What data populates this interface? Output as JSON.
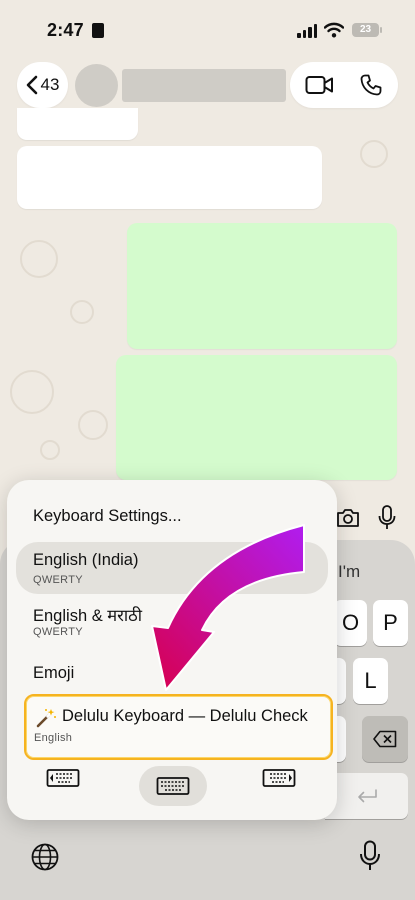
{
  "status_bar": {
    "time": "2:47",
    "battery": "23"
  },
  "nav": {
    "back_count": "43"
  },
  "keyboard": {
    "suggestion": "I'm",
    "keys_row2": [
      "O",
      "P"
    ],
    "keys_row3": [
      "L"
    ]
  },
  "popup": {
    "settings": "Keyboard Settings...",
    "items": [
      {
        "label": "English (India)",
        "sub": "QWERTY"
      },
      {
        "label": "English & मराठी",
        "sub": "QWERTY"
      },
      {
        "label": "Emoji"
      },
      {
        "label": "Delulu Keyboard — Delulu Check",
        "sub": "English"
      }
    ]
  },
  "colors": {
    "bubble_green": "#d4fbcd",
    "highlight_border": "#f6b320",
    "arrow_start": "#b01df0",
    "arrow_end": "#d8004e"
  },
  "icons": [
    "chevron-left-icon",
    "video-icon",
    "phone-icon",
    "camera-icon",
    "microphone-icon",
    "globe-icon",
    "keyboard-left-icon",
    "keyboard-center-icon",
    "keyboard-right-icon",
    "delete-icon",
    "return-icon",
    "magic-wand-icon"
  ]
}
